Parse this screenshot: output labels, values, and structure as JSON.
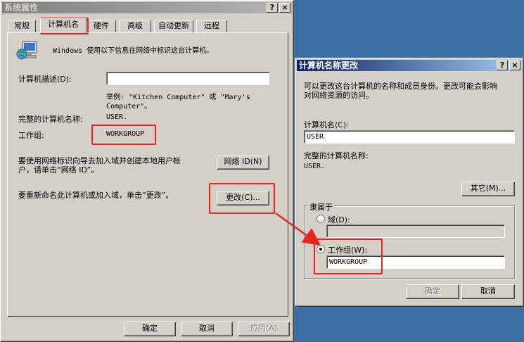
{
  "props_window": {
    "title": "系统属性",
    "help_btn": "?",
    "close_btn": "×",
    "tabs": [
      "常规",
      "计算机名",
      "硬件",
      "高级",
      "自动更新",
      "远程"
    ],
    "intro": "Windows 使用以下信息在网络中标识这台计算机。",
    "desc_label": "计算机描述(D):",
    "desc_value": "",
    "example_line1": "举例: \"Kitchen Computer\" 或 \"Mary's",
    "example_line2": "Computer\"。",
    "fullname_label": "完整的计算机名称:",
    "fullname_value": "USER.",
    "workgroup_label": "工作组:",
    "workgroup_value": "WORKGROUP",
    "netid_text_line1": "要使用网络标识向导去加入域并创建本地用户帐",
    "netid_text_line2": "户，请单击“网络 ID”。",
    "netid_button": "网络 ID(N)",
    "rename_text": "要重新命名此计算机或加入域，单击“更改”。",
    "change_button": "更改(C)...",
    "ok_button": "确定",
    "cancel_button": "取消",
    "apply_button": "应用(A)"
  },
  "rename_dialog": {
    "title": "计算机名称更改",
    "help_btn": "?",
    "close_btn": "×",
    "intro_line1": "可以更改这台计算机的名称和成员身份。更改可能会影响",
    "intro_line2": "对网络资源的访问。",
    "name_label": "计算机名(C):",
    "name_value": "USER",
    "fullname_label": "完整的计算机名称:",
    "fullname_value": "USER.",
    "other_button": "其它(M)...",
    "member_group_label": "隶属于",
    "domain_radio_label": "域(D):",
    "domain_value": "",
    "workgroup_radio_label": "工作组(W):",
    "workgroup_value": "WORKGROUP",
    "ok_button": "确定",
    "cancel_button": "取消"
  },
  "colors": {
    "highlight": "#e8261c",
    "desktop": "#3a6ea5",
    "dialog": "#d4d0c8"
  }
}
